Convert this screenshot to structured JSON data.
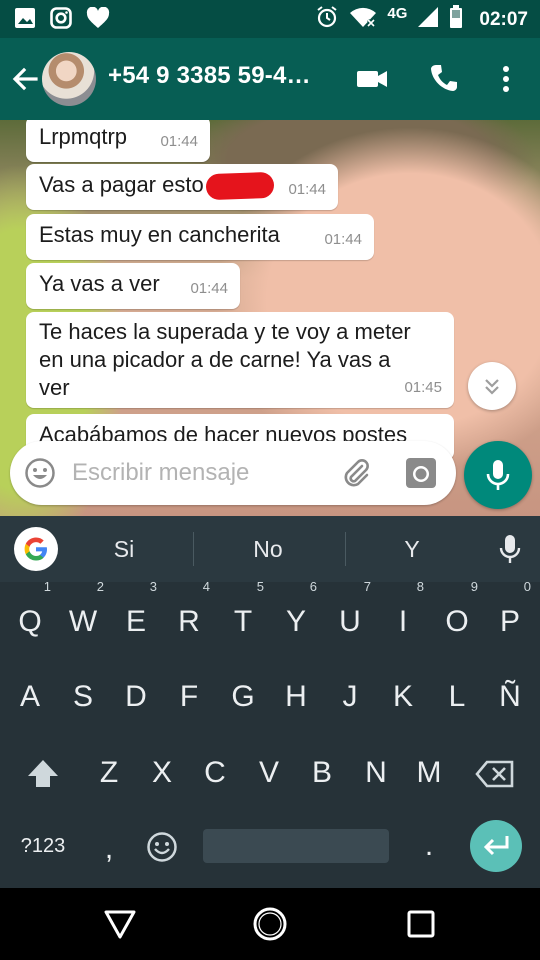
{
  "status_bar": {
    "network": "4G",
    "time": "02:07",
    "left_icons": [
      "gallery-icon",
      "instagram-icon",
      "heart-icon"
    ],
    "right_icons": [
      "alarm-icon",
      "wifi-icon",
      "signal-icon",
      "battery-icon"
    ]
  },
  "header": {
    "contact": "+54 9 3385 59-4…",
    "actions": [
      "video-call-icon",
      "phone-icon",
      "more-icon"
    ]
  },
  "messages": [
    {
      "text": "Lrpmqtrp",
      "time": "01:44"
    },
    {
      "text": "Vas a pagar esto",
      "time": "01:44",
      "redacted": true
    },
    {
      "text": "Estas muy en cancherita",
      "time": "01:44"
    },
    {
      "text": "Ya vas a ver",
      "time": "01:44"
    },
    {
      "text_line1": "Te haces la superada y te voy a meter",
      "text_line2": "en una picador a de carne! Ya vas a",
      "text_line3": "ver",
      "time": "01:45"
    },
    {
      "text": "Acabábamos de hacer nuevos postes"
    }
  ],
  "composer": {
    "placeholder": "Escribir mensaje"
  },
  "keyboard": {
    "suggestions": [
      "Si",
      "No",
      "Y"
    ],
    "row1": [
      {
        "key": "Q",
        "hint": "1"
      },
      {
        "key": "W",
        "hint": "2"
      },
      {
        "key": "E",
        "hint": "3"
      },
      {
        "key": "R",
        "hint": "4"
      },
      {
        "key": "T",
        "hint": "5"
      },
      {
        "key": "Y",
        "hint": "6"
      },
      {
        "key": "U",
        "hint": "7"
      },
      {
        "key": "I",
        "hint": "8"
      },
      {
        "key": "O",
        "hint": "9"
      },
      {
        "key": "P",
        "hint": "0"
      }
    ],
    "row2": [
      "A",
      "S",
      "D",
      "F",
      "G",
      "H",
      "J",
      "K",
      "L",
      "Ñ"
    ],
    "row3": [
      "Z",
      "X",
      "C",
      "V",
      "B",
      "N",
      "M"
    ],
    "symbols_key": "?123",
    "comma_key": ",",
    "period_key": "."
  },
  "colors": {
    "status_bar": "#054d44",
    "app_bar": "#075e54",
    "accent": "#00897b",
    "redaction": "#e5141c",
    "keyboard_bg": "#263238"
  }
}
